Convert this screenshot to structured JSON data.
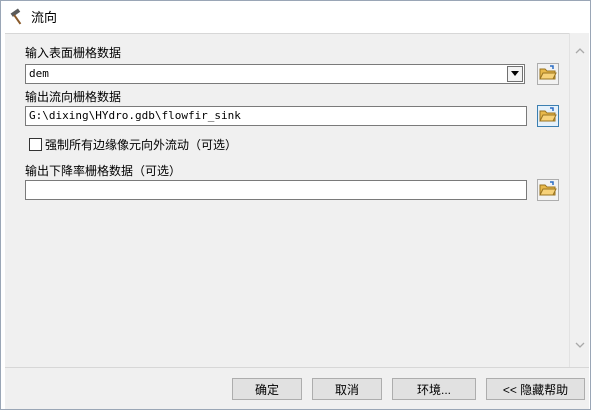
{
  "window": {
    "title": "流向"
  },
  "form": {
    "input_raster": {
      "label": "输入表面栅格数据",
      "value": "dem"
    },
    "output_flow": {
      "label": "输出流向栅格数据",
      "value": "G:\\dixing\\HYdro.gdb\\flowfir_sink"
    },
    "force_edge": {
      "label": "强制所有边缘像元向外流动（可选）",
      "checked": false
    },
    "output_drop": {
      "label": "输出下降率栅格数据（可选）",
      "value": ""
    }
  },
  "buttons": {
    "ok": "确定",
    "cancel": "取消",
    "environments": "环境...",
    "hide_help": "<< 隐藏帮助"
  },
  "icons": {
    "title": "hammer-icon",
    "browse": "folder-open-icon",
    "dropdown": "chevron-down-icon"
  }
}
